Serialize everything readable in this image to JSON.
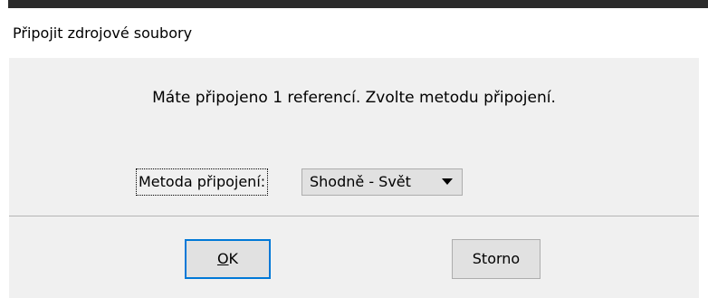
{
  "window": {
    "title": "Připojit zdrojové soubory"
  },
  "message": "Máte připojeno 1 referencí. Zvolte metodu připojení.",
  "method": {
    "label": "Metoda připojení:",
    "selected": "Shodně - Svět"
  },
  "buttons": {
    "ok_prefix": "O",
    "ok_rest": "K",
    "cancel": "Storno"
  },
  "colors": {
    "dialog_bg": "#f0f0f0",
    "titlebar_bg": "#ffffff",
    "button_bg": "#e1e1e1",
    "focus_border": "#0078d7"
  }
}
